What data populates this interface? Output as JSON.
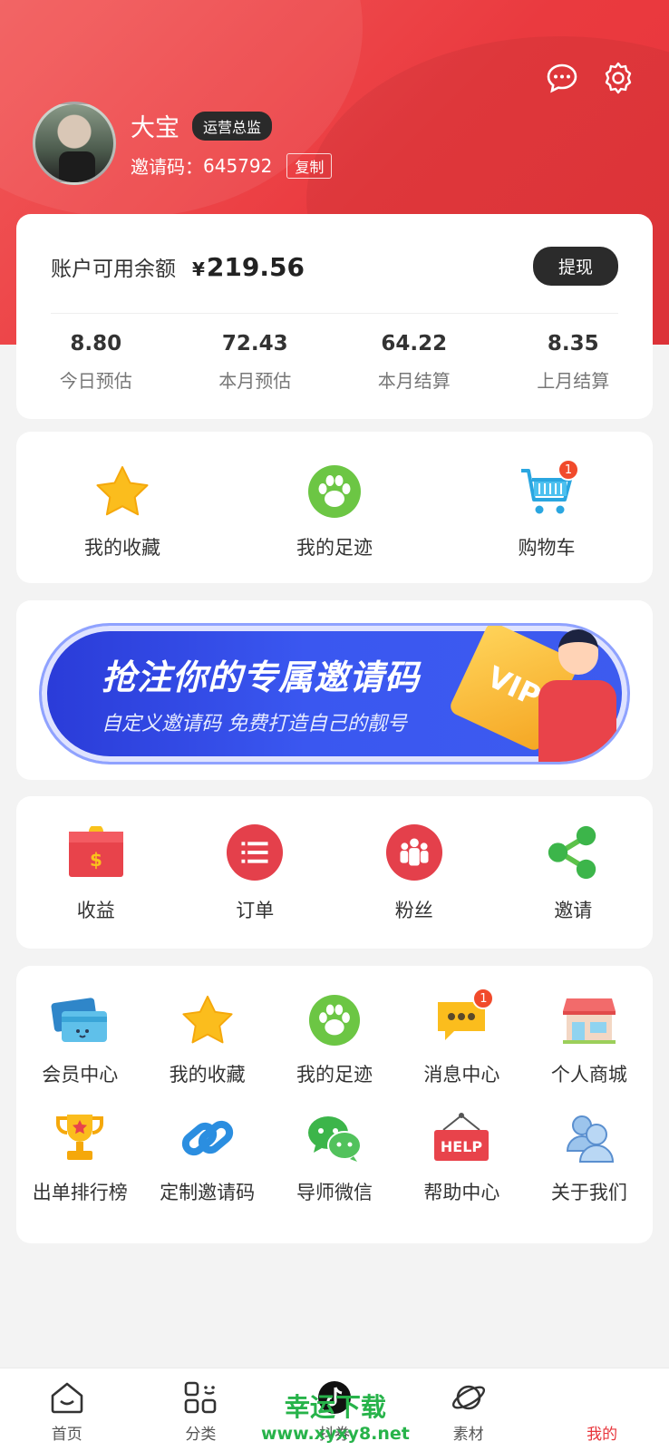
{
  "profile": {
    "name": "大宝",
    "role": "运营总监",
    "invite_label": "邀请码：",
    "invite_code": "645792",
    "copy_label": "复制"
  },
  "balance": {
    "label": "账户可用余额",
    "currency": "¥",
    "amount": "219.56",
    "withdraw_label": "提现",
    "stats": [
      {
        "value": "8.80",
        "label": "今日预估"
      },
      {
        "value": "72.43",
        "label": "本月预估"
      },
      {
        "value": "64.22",
        "label": "本月结算"
      },
      {
        "value": "8.35",
        "label": "上月结算"
      }
    ]
  },
  "quick": [
    {
      "label": "我的收藏",
      "icon": "star-icon"
    },
    {
      "label": "我的足迹",
      "icon": "paw-icon"
    },
    {
      "label": "购物车",
      "icon": "cart-icon",
      "badge": "1"
    }
  ],
  "banner": {
    "title": "抢注你的专属邀请码",
    "subtitle": "自定义邀请码 免费打造自己的靓号",
    "vip": "VIP"
  },
  "menu": [
    {
      "label": "收益",
      "icon": "red-envelope-icon"
    },
    {
      "label": "订单",
      "icon": "list-icon"
    },
    {
      "label": "粉丝",
      "icon": "fans-icon"
    },
    {
      "label": "邀请",
      "icon": "share-icon"
    }
  ],
  "grid": [
    {
      "label": "会员中心",
      "icon": "card-icon"
    },
    {
      "label": "我的收藏",
      "icon": "star-icon"
    },
    {
      "label": "我的足迹",
      "icon": "paw-icon"
    },
    {
      "label": "消息中心",
      "icon": "message-icon",
      "badge": "1"
    },
    {
      "label": "个人商城",
      "icon": "shop-icon"
    },
    {
      "label": "出单排行榜",
      "icon": "trophy-icon"
    },
    {
      "label": "定制邀请码",
      "icon": "link-icon"
    },
    {
      "label": "导师微信",
      "icon": "wechat-icon"
    },
    {
      "label": "帮助中心",
      "icon": "help-icon",
      "sign": "HELP"
    },
    {
      "label": "关于我们",
      "icon": "people-icon"
    }
  ],
  "tabs": [
    {
      "label": "首页",
      "icon": "home-icon"
    },
    {
      "label": "分类",
      "icon": "category-icon"
    },
    {
      "label": "抖券",
      "icon": "tiktok-icon"
    },
    {
      "label": "素材",
      "icon": "planet-icon"
    },
    {
      "label": "我的",
      "icon": "user-icon",
      "active": true
    }
  ],
  "watermark": {
    "line1": "幸运下载",
    "line2": "www.xyxy8.net"
  },
  "colors": {
    "brand_red": "#e8353b",
    "accent_yellow": "#f9b21f",
    "accent_green": "#5cc24a"
  }
}
